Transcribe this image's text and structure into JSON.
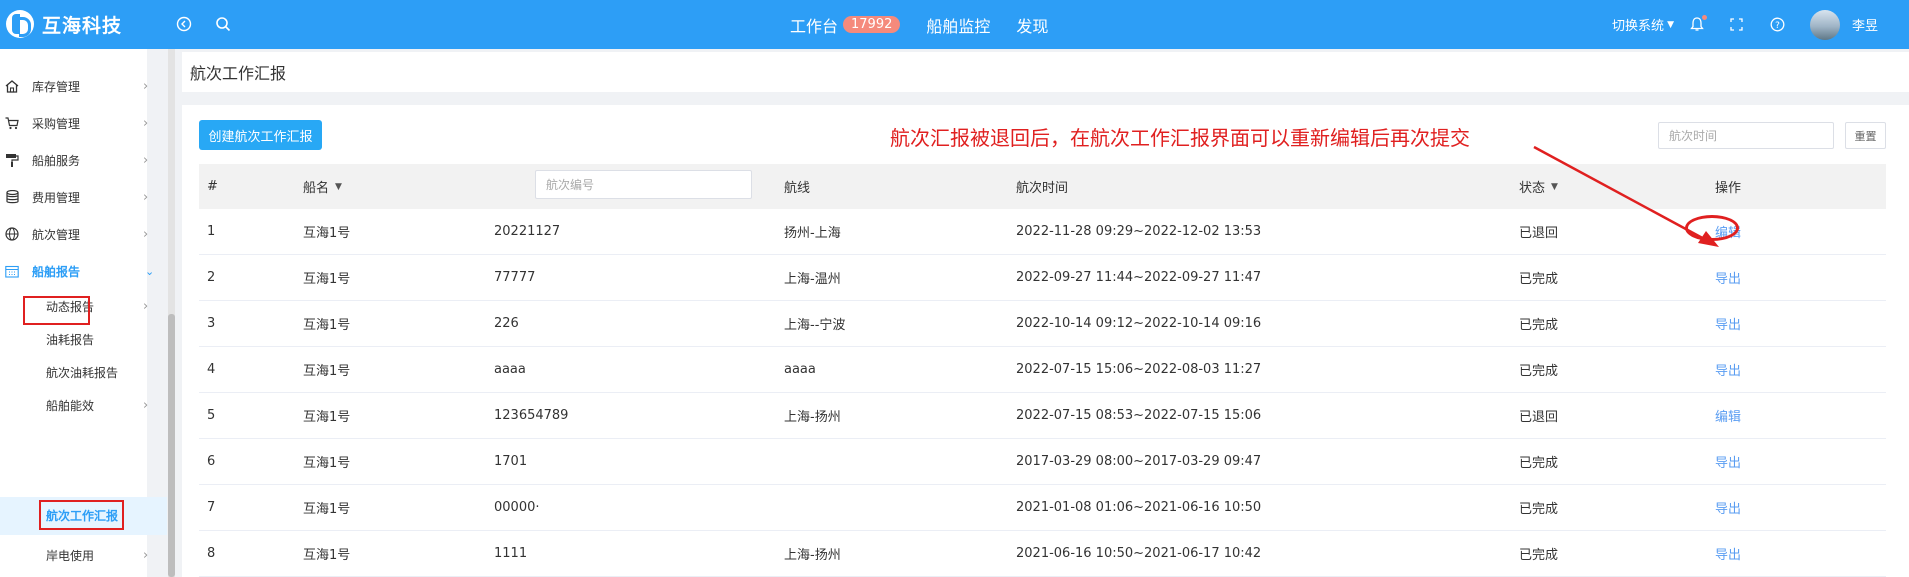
{
  "app": {
    "brand": "互海科技"
  },
  "topbar": {
    "nav": [
      {
        "label": "工作台",
        "badge": "17992"
      },
      {
        "label": "船舶监控"
      },
      {
        "label": "发现"
      }
    ],
    "switch_system": "切换系统",
    "user_name": "李昱"
  },
  "sidebar": {
    "items": [
      {
        "label": "库存管理",
        "icon": "home-icon"
      },
      {
        "label": "采购管理",
        "icon": "cart-icon"
      },
      {
        "label": "船舶服务",
        "icon": "brush-icon"
      },
      {
        "label": "费用管理",
        "icon": "database-icon"
      },
      {
        "label": "航次管理",
        "icon": "globe-icon"
      },
      {
        "label": "船舶报告",
        "icon": "calendar-icon"
      }
    ],
    "subitems": [
      {
        "label": "动态报告"
      },
      {
        "label": "油耗报告"
      },
      {
        "label": "航次油耗报告"
      },
      {
        "label": "船舶能效"
      },
      {
        "label": "航次工作汇报"
      },
      {
        "label": "岸电使用"
      }
    ]
  },
  "page": {
    "title": "航次工作汇报"
  },
  "toolbar": {
    "create_label": "创建航次工作汇报",
    "date_placeholder": "航次时间",
    "reset_label": "重置"
  },
  "annotation": {
    "text": "航次汇报被退回后，在航次工作汇报界面可以重新编辑后再次提交",
    "color": "#e02020"
  },
  "table": {
    "headers": {
      "index": "#",
      "ship": "船名",
      "voyage_no_placeholder": "航次编号",
      "route": "航线",
      "time": "航次时间",
      "status": "状态",
      "action": "操作"
    },
    "rows": [
      {
        "index": "1",
        "ship": "互海1号",
        "voyage_no": "20221127",
        "route": "扬州-上海",
        "time": "2022-11-28 09:29~2022-12-02 13:53",
        "status": "已退回",
        "action": "编辑"
      },
      {
        "index": "2",
        "ship": "互海1号",
        "voyage_no": "77777",
        "route": "上海-温州",
        "time": "2022-09-27 11:44~2022-09-27 11:47",
        "status": "已完成",
        "action": "导出"
      },
      {
        "index": "3",
        "ship": "互海1号",
        "voyage_no": "226",
        "route": "上海--宁波",
        "time": "2022-10-14 09:12~2022-10-14 09:16",
        "status": "已完成",
        "action": "导出"
      },
      {
        "index": "4",
        "ship": "互海1号",
        "voyage_no": "aaaa",
        "route": "aaaa",
        "time": "2022-07-15 15:06~2022-08-03 11:27",
        "status": "已完成",
        "action": "导出"
      },
      {
        "index": "5",
        "ship": "互海1号",
        "voyage_no": "123654789",
        "route": "上海-扬州",
        "time": "2022-07-15 08:53~2022-07-15 15:06",
        "status": "已退回",
        "action": "编辑"
      },
      {
        "index": "6",
        "ship": "互海1号",
        "voyage_no": "1701",
        "route": "",
        "time": "2017-03-29 08:00~2017-03-29 09:47",
        "status": "已完成",
        "action": "导出"
      },
      {
        "index": "7",
        "ship": "互海1号",
        "voyage_no": "00000·",
        "route": "",
        "time": "2021-01-08 01:06~2021-06-16 10:50",
        "status": "已完成",
        "action": "导出"
      },
      {
        "index": "8",
        "ship": "互海1号",
        "voyage_no": "1111",
        "route": "上海-扬州",
        "time": "2021-06-16 10:50~2021-06-17 10:42",
        "status": "已完成",
        "action": "导出"
      }
    ]
  }
}
